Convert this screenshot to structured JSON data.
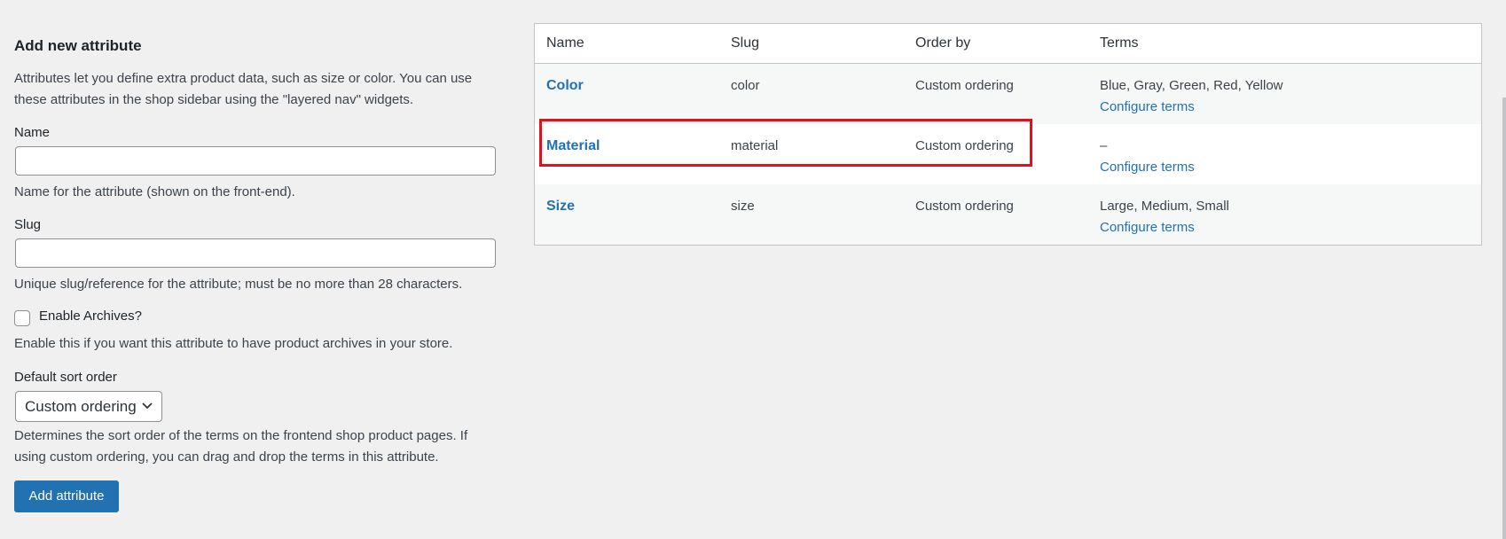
{
  "form": {
    "title": "Add new attribute",
    "intro": "Attributes let you define extra product data, such as size or color. You can use these attributes in the shop sidebar using the \"layered nav\" widgets.",
    "name_label": "Name",
    "name_value": "",
    "name_desc": "Name for the attribute (shown on the front-end).",
    "slug_label": "Slug",
    "slug_value": "",
    "slug_desc": "Unique slug/reference for the attribute; must be no more than 28 characters.",
    "archives_label": "Enable Archives?",
    "archives_checked": false,
    "archives_desc": "Enable this if you want this attribute to have product archives in your store.",
    "sort_label": "Default sort order",
    "sort_value": "Custom ordering",
    "sort_desc": "Determines the sort order of the terms on the frontend shop product pages. If using custom ordering, you can drag and drop the terms in this attribute.",
    "submit_label": "Add attribute"
  },
  "table": {
    "headers": [
      "Name",
      "Slug",
      "Order by",
      "Terms"
    ],
    "rows": [
      {
        "name": "Color",
        "slug": "color",
        "order_by": "Custom ordering",
        "terms": "Blue, Gray, Green, Red, Yellow",
        "action": "Configure terms"
      },
      {
        "name": "Material",
        "slug": "material",
        "order_by": "Custom ordering",
        "terms": "–",
        "action": "Configure terms"
      },
      {
        "name": "Size",
        "slug": "size",
        "order_by": "Custom ordering",
        "terms": "Large, Medium, Small",
        "action": "Configure terms"
      }
    ]
  },
  "colors": {
    "link": "#2271b1",
    "button": "#2271b1",
    "highlight": "#e0111d",
    "background": "#f0f0f1"
  },
  "icons": {
    "select_arrow": "chevron-down-icon"
  }
}
